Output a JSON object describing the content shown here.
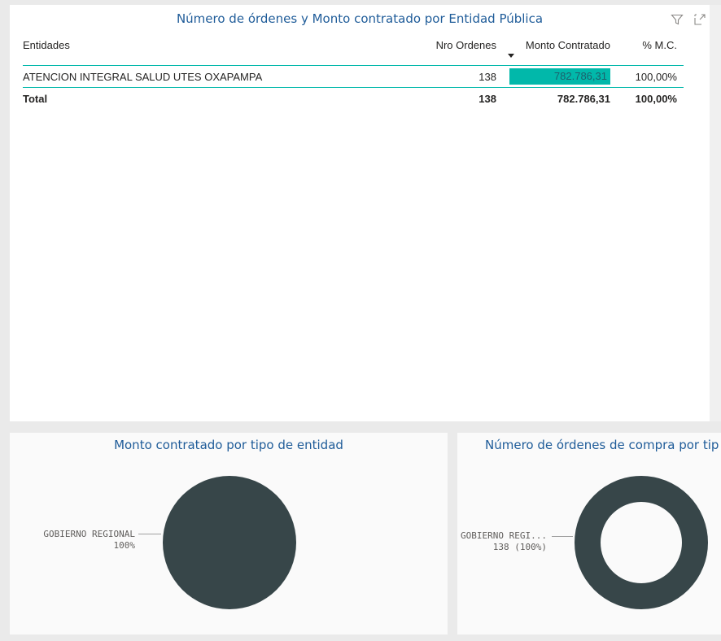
{
  "table_visual": {
    "title": "Número de órdenes y Monto contratado por Entidad Pública",
    "icons": [
      "filter-icon",
      "focus-mode-icon"
    ],
    "columns": {
      "entidades": "Entidades",
      "nro_ordenes": "Nro Ordenes",
      "monto": "Monto Contratado",
      "pct": "% M.C."
    },
    "rows": [
      {
        "entidad": "ATENCION INTEGRAL SALUD UTES OXAPAMPA",
        "nro_ordenes": "138",
        "monto": "782.786,31",
        "pct": "100,00%",
        "bar_fraction": 1.0
      }
    ],
    "total": {
      "label": "Total",
      "nro_ordenes": "138",
      "monto": "782.786,31",
      "pct": "100,00%"
    },
    "accent_color": "#01b8aa"
  },
  "pie_visual": {
    "title": "Monto contratado por tipo de entidad",
    "slice_label": "GOBIERNO REGIONAL",
    "slice_value": "100%",
    "color": "#374649"
  },
  "donut_visual": {
    "title": "Número de órdenes de compra por tip",
    "slice_label": "GOBIERNO REGI...",
    "slice_value": "138 (100%)",
    "color": "#374649"
  }
}
